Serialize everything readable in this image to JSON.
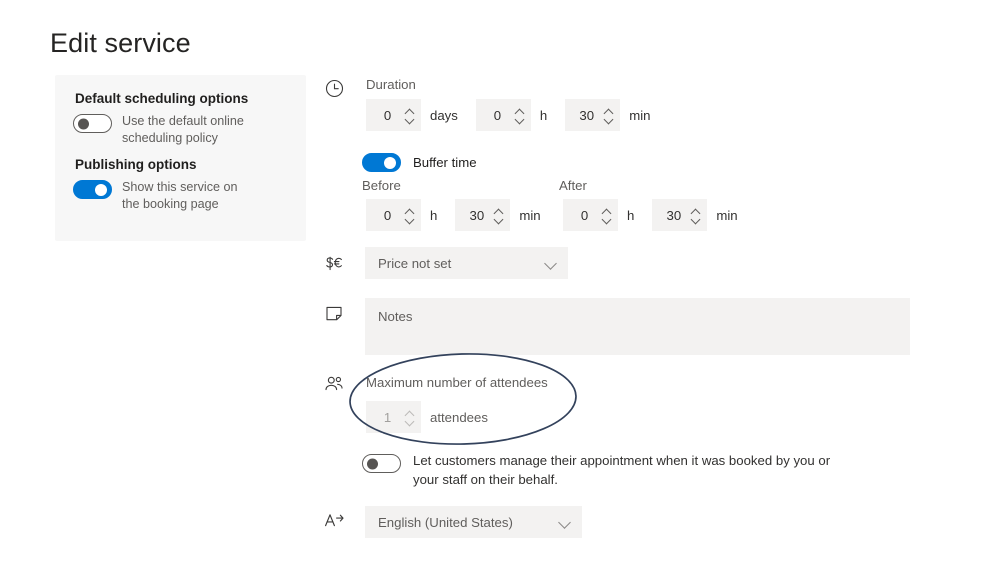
{
  "page": {
    "title": "Edit service"
  },
  "options_card": {
    "scheduling": {
      "heading": "Default scheduling options",
      "toggle_label": "Use the default online scheduling policy",
      "toggle_state": "off"
    },
    "publishing": {
      "heading": "Publishing options",
      "toggle_label": "Show this service on the booking page",
      "toggle_state": "on"
    }
  },
  "form": {
    "duration": {
      "icon": "clock-icon",
      "label": "Duration",
      "days": {
        "value": "0",
        "unit": "days"
      },
      "hours": {
        "value": "0",
        "unit": "h"
      },
      "minutes": {
        "value": "30",
        "unit": "min"
      }
    },
    "buffer_time": {
      "toggle_label": "Buffer time",
      "toggle_state": "on",
      "before": {
        "label": "Before",
        "hours": {
          "value": "0",
          "unit": "h"
        },
        "minutes": {
          "value": "30",
          "unit": "min"
        }
      },
      "after": {
        "label": "After",
        "hours": {
          "value": "0",
          "unit": "h"
        },
        "minutes": {
          "value": "30",
          "unit": "min"
        }
      }
    },
    "price": {
      "icon": "currency-icon",
      "selected": "Price not set"
    },
    "notes": {
      "icon": "note-icon",
      "placeholder": "Notes"
    },
    "attendees": {
      "icon": "people-icon",
      "label": "Maximum number of attendees",
      "value": "1",
      "unit": "attendees"
    },
    "self_manage": {
      "toggle_label": "Let customers manage their appointment when it was booked by you or your staff on their behalf.",
      "toggle_state": "off"
    },
    "language": {
      "icon": "translate-icon",
      "selected": "English (United States)"
    }
  },
  "annotation": {
    "shape": "ellipse",
    "color": "#2f3e57",
    "target": "Maximum number of attendees"
  },
  "colors": {
    "accent": "#0078d4",
    "field_bg": "#f3f2f1",
    "card_bg": "#f7f7f7",
    "text_primary": "#201f1e",
    "text_secondary": "#605e5c"
  }
}
